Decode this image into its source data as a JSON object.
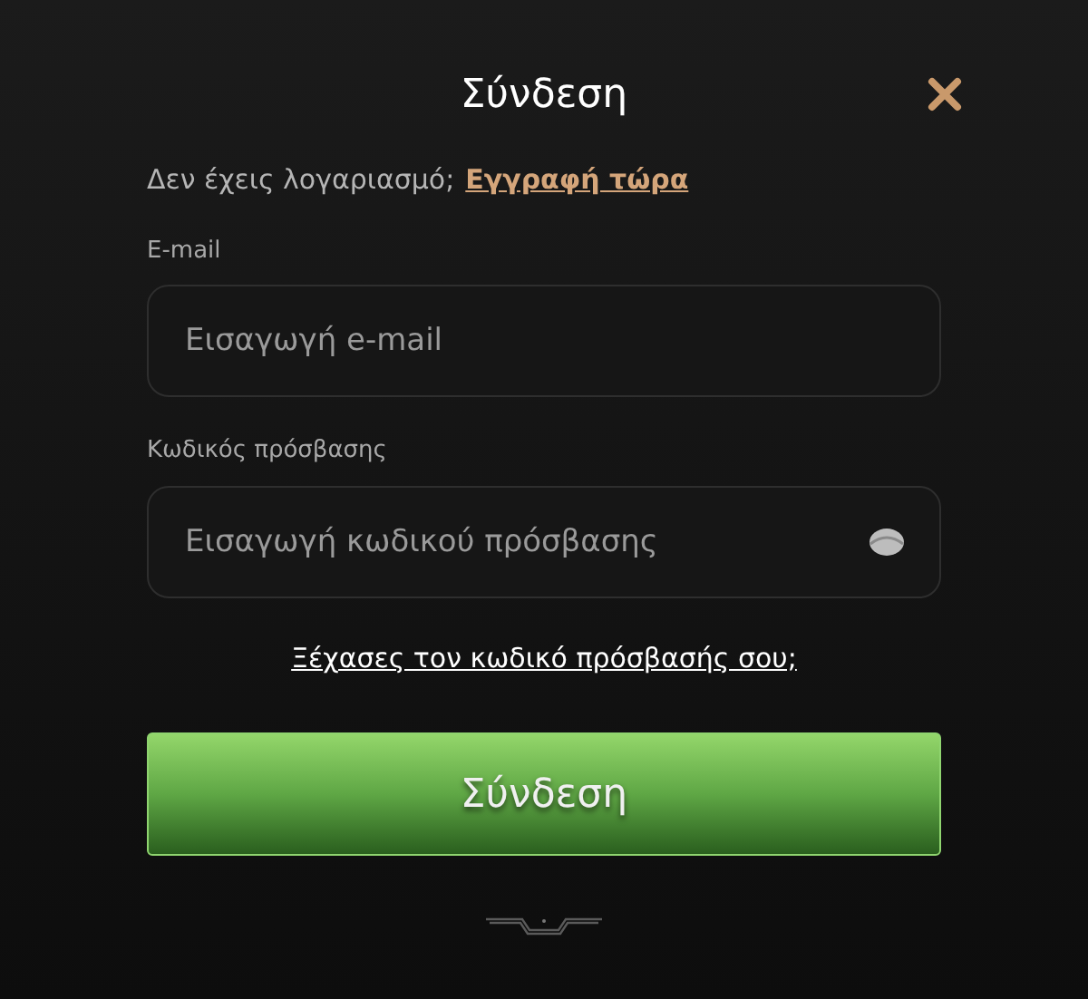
{
  "title": "Σύνδεση",
  "signup": {
    "prompt": "Δεν έχεις λογαριασμό;",
    "link": "Εγγραφή τώρα"
  },
  "fields": [
    {
      "label": "E-mail",
      "placeholder": "Εισαγωγή e-mail",
      "kind": "text"
    },
    {
      "label": "Κωδικός πρόσβασης",
      "placeholder": "Εισαγωγή κωδικού πρόσβασης",
      "kind": "password"
    }
  ],
  "forgot_link": "Ξέχασες τον κωδικό πρόσβασής σου;",
  "submit": "Σύνδεση"
}
